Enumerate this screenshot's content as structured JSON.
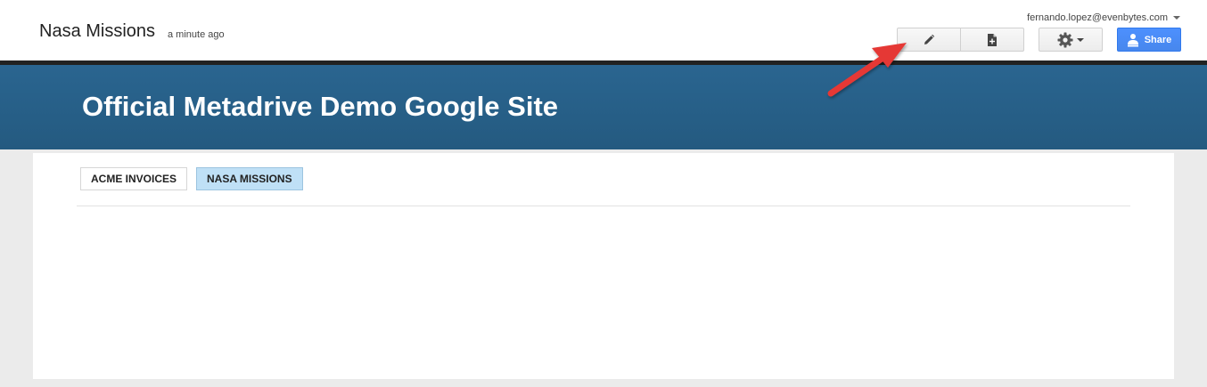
{
  "header": {
    "page_title": "Nasa Missions",
    "timestamp": "a minute ago",
    "account_email": "fernando.lopez@evenbytes.com",
    "share_label": "Share"
  },
  "toolbar": {
    "edit_icon": "pencil-icon",
    "new_page_icon": "new-page-icon",
    "settings_icon": "gear-icon"
  },
  "site": {
    "title": "Official Metadrive Demo Google Site"
  },
  "nav": {
    "tabs": [
      {
        "label": "ACME INVOICES",
        "active": false
      },
      {
        "label": "NASA MISSIONS",
        "active": true
      }
    ]
  },
  "colors": {
    "banner": "#2a6590",
    "share_button": "#4d90fe",
    "active_tab": "#bfe0f6",
    "annotation_arrow": "#e53935"
  }
}
